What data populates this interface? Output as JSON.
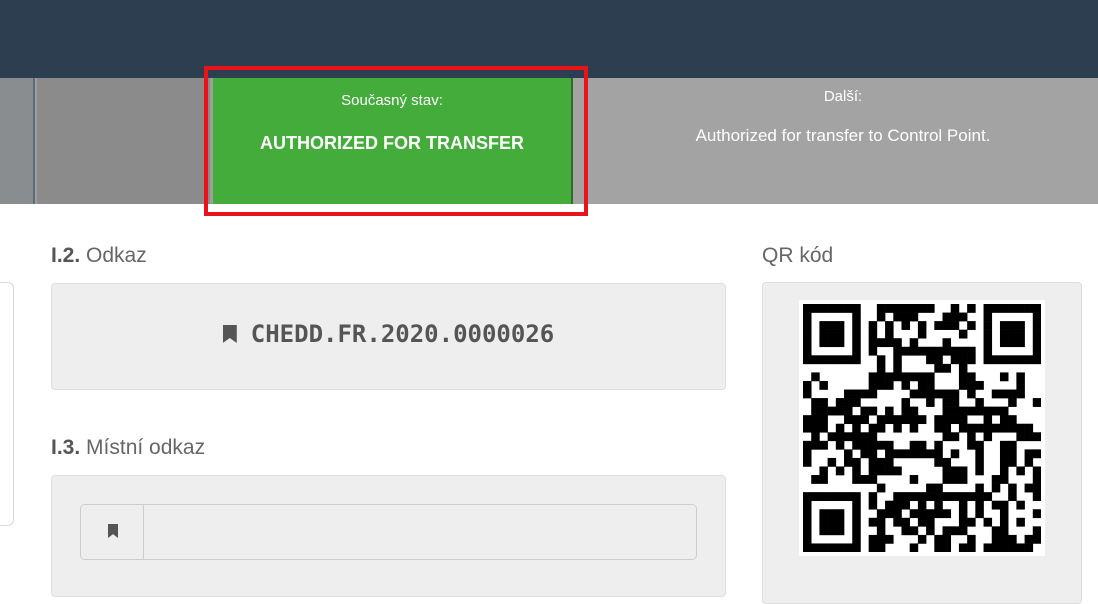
{
  "status": {
    "current_label": "Současný stav:",
    "current_value": "AUTHORIZED FOR TRANSFER",
    "next_label": "Další:",
    "next_value": "Authorized for transfer to Control Point."
  },
  "fields": {
    "reference": {
      "number": "I.2.",
      "label": "Odkaz",
      "value": "CHEDD.FR.2020.0000026"
    },
    "local_reference": {
      "number": "I.3.",
      "label": "Místní odkaz",
      "value": "",
      "placeholder": ""
    },
    "qr": {
      "label": "QR kód"
    }
  },
  "icons": {
    "reference": "bookmark-icon",
    "local_reference": "bookmark-icon"
  },
  "colors": {
    "header": "#2c3e50",
    "current_status": "#43ac3b",
    "next_status": "#a3a3a3",
    "highlight": "#e8141a"
  }
}
